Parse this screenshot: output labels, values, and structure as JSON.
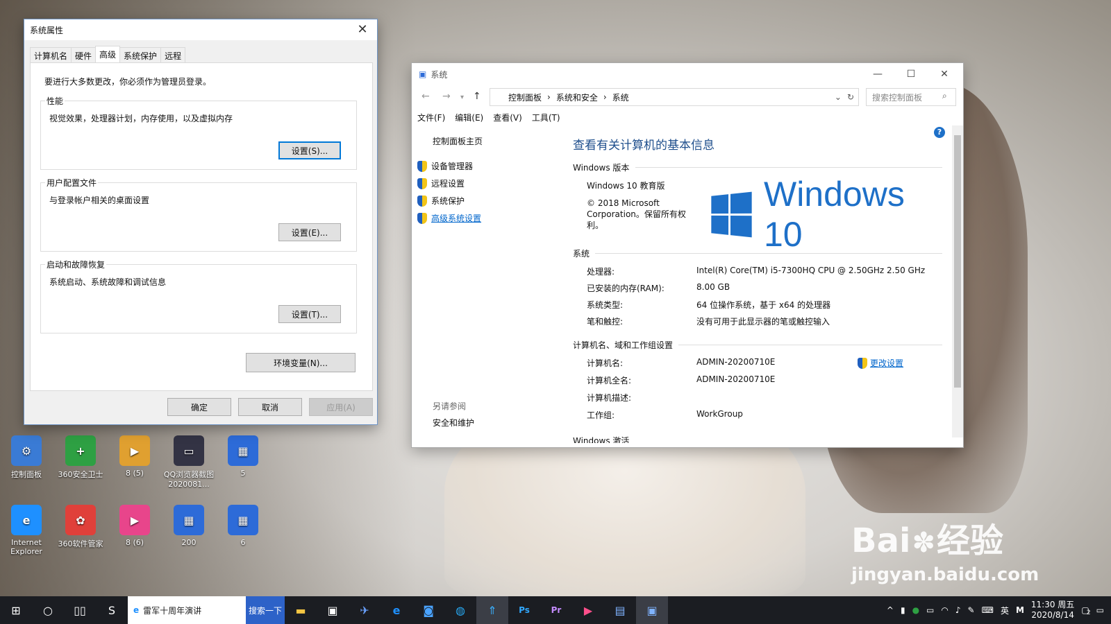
{
  "desktop": {
    "icons": [
      {
        "label": "控制面板",
        "color": "#3a7bd5",
        "glyph": "⚙"
      },
      {
        "label": "360安全卫士",
        "color": "#2ea043",
        "glyph": "+"
      },
      {
        "label": "8 (5)",
        "color": "#e0a030",
        "glyph": "▶"
      },
      {
        "label": "QQ浏览器截图2020081...",
        "color": "#334",
        "glyph": "▭"
      },
      {
        "label": "5",
        "color": "#2d6bd8",
        "glyph": "▦"
      },
      {
        "label": "Internet Explorer",
        "color": "#1e90ff",
        "glyph": "e"
      },
      {
        "label": "360软件管家",
        "color": "#e0403a",
        "glyph": "✿"
      },
      {
        "label": "8 (6)",
        "color": "#e8458b",
        "glyph": "▶"
      },
      {
        "label": "200",
        "color": "#2d6bd8",
        "glyph": "▦"
      },
      {
        "label": "6",
        "color": "#2d6bd8",
        "glyph": "▦"
      }
    ]
  },
  "sysprops": {
    "title": "系统属性",
    "tabs": [
      "计算机名",
      "硬件",
      "高级",
      "系统保护",
      "远程"
    ],
    "active_tab": "高级",
    "note": "要进行大多数更改，你必须作为管理员登录。",
    "performance": {
      "title": "性能",
      "desc": "视觉效果，处理器计划，内存使用，以及虚拟内存",
      "button": "设置(S)..."
    },
    "user_profiles": {
      "title": "用户配置文件",
      "desc": "与登录帐户相关的桌面设置",
      "button": "设置(E)..."
    },
    "startup": {
      "title": "启动和故障恢复",
      "desc": "系统启动、系统故障和调试信息",
      "button": "设置(T)..."
    },
    "env_button": "环境变量(N)...",
    "ok": "确定",
    "cancel": "取消",
    "apply": "应用(A)"
  },
  "system": {
    "title": "系统",
    "breadcrumb": [
      "控制面板",
      "系统和安全",
      "系统"
    ],
    "search_placeholder": "搜索控制面板",
    "menu": [
      "文件(F)",
      "编辑(E)",
      "查看(V)",
      "工具(T)"
    ],
    "sidebar_home": "控制面板主页",
    "sidebar_links": [
      "设备管理器",
      "远程设置",
      "系统保护",
      "高级系统设置"
    ],
    "see_also": "另请参阅",
    "security": "安全和维护",
    "heading": "查看有关计算机的基本信息",
    "edition_section": "Windows 版本",
    "edition": "Windows 10 教育版",
    "copyright": "© 2018 Microsoft Corporation。保留所有权利。",
    "logo_text": "Windows 10",
    "system_section": "系统",
    "specs": [
      {
        "label": "处理器:",
        "value": "Intel(R) Core(TM) i5-7300HQ CPU @ 2.50GHz   2.50 GHz"
      },
      {
        "label": "已安装的内存(RAM):",
        "value": "8.00 GB"
      },
      {
        "label": "系统类型:",
        "value": "64 位操作系统，基于 x64 的处理器"
      },
      {
        "label": "笔和触控:",
        "value": "没有可用于此显示器的笔或触控输入"
      }
    ],
    "computer_section": "计算机名、域和工作组设置",
    "computer": [
      {
        "label": "计算机名:",
        "value": "ADMIN-20200710E"
      },
      {
        "label": "计算机全名:",
        "value": "ADMIN-20200710E"
      },
      {
        "label": "计算机描述:",
        "value": ""
      },
      {
        "label": "工作组:",
        "value": "WorkGroup"
      }
    ],
    "change_settings": "更改设置",
    "activation_section": "Windows 激活"
  },
  "taskbar": {
    "search_text": "雷军十周年演讲",
    "search_button": "搜索一下",
    "ime": "英",
    "time": "11:30 周五",
    "date": "2020/8/14",
    "notif_count": "2"
  },
  "watermark": {
    "brand": "Bai",
    "brand2": "经验",
    "url": "jingyan.baidu.com"
  }
}
